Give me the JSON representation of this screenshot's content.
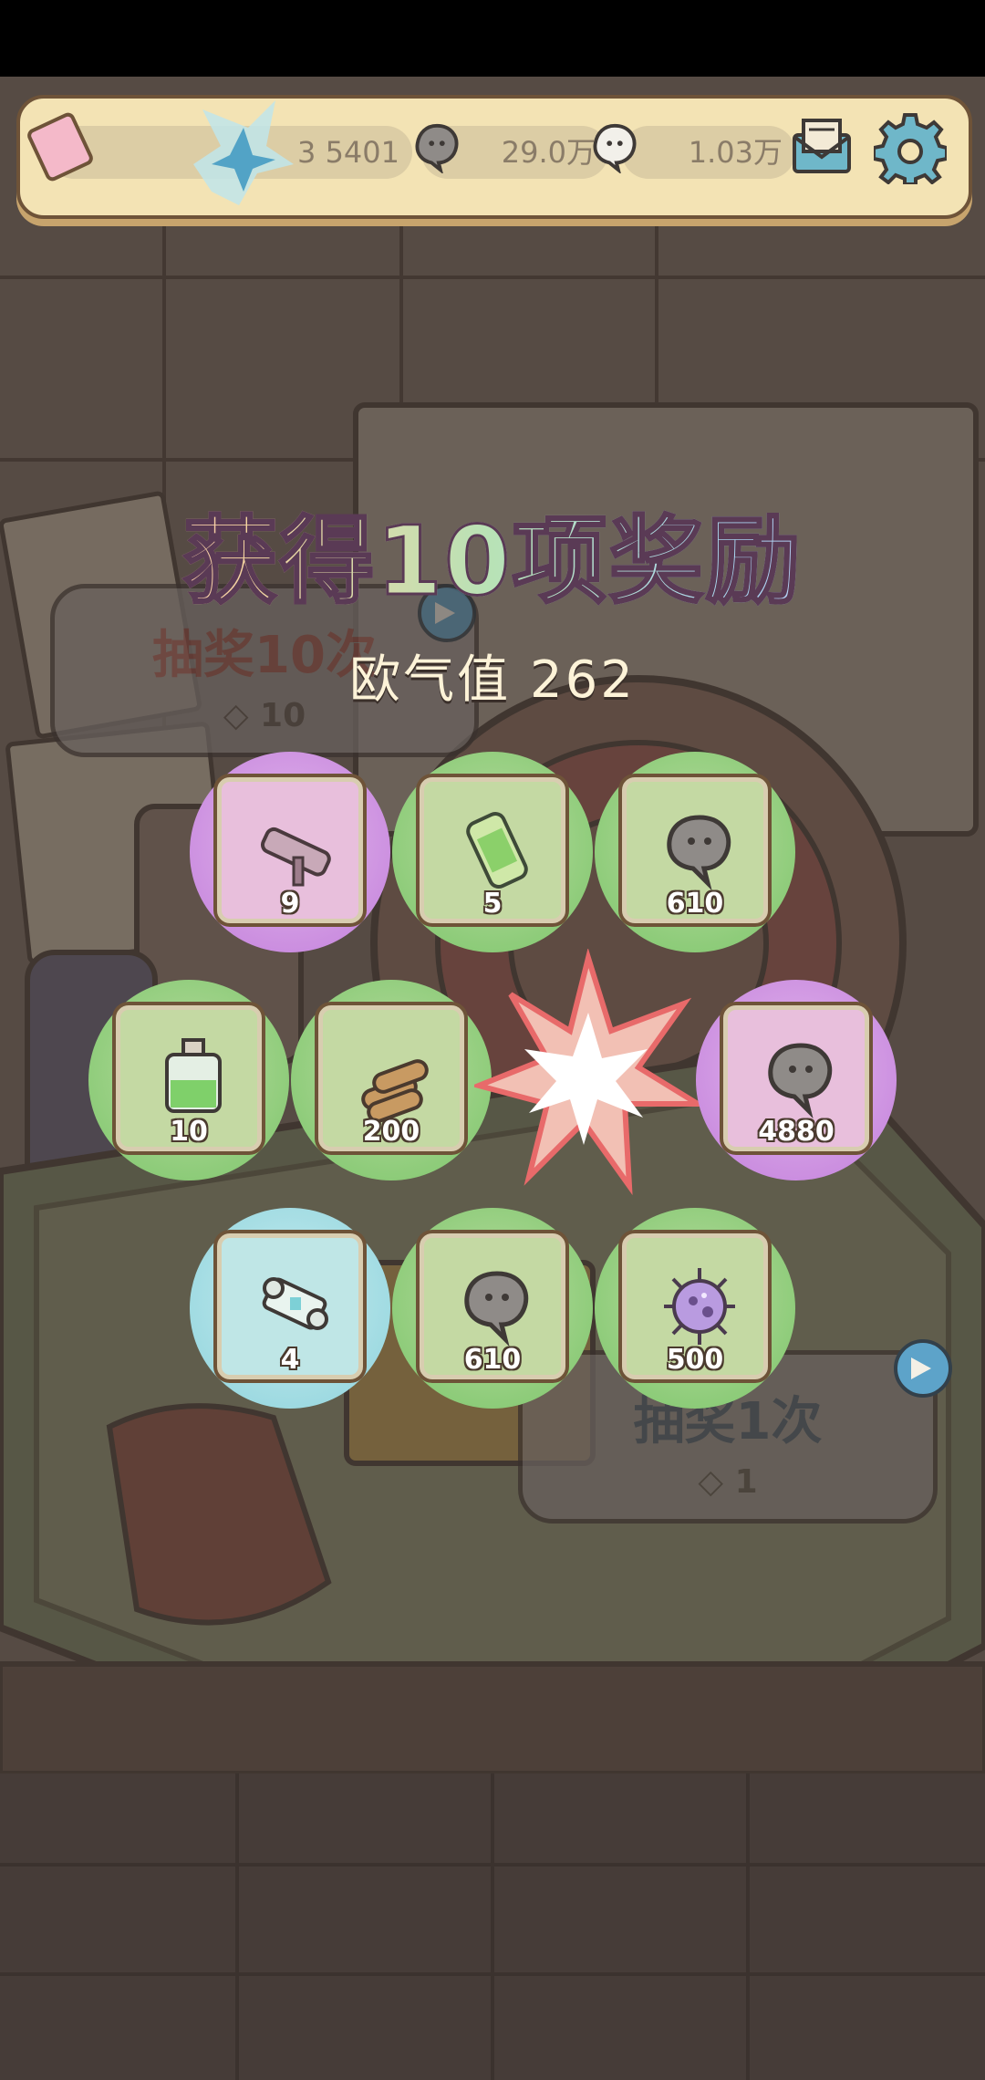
{
  "resources": {
    "ticket_value": "3   5401",
    "ghost_value": "29.0万",
    "soul_value": "1.03万"
  },
  "title": "获得10项奖励",
  "luck_text": "欧气值 262",
  "draw10": {
    "label": "抽奖10次",
    "cost": "10"
  },
  "draw1": {
    "label": "抽奖1次",
    "cost": "1"
  },
  "rewards": [
    {
      "name": "cannon",
      "quantity": "9",
      "rarity": "purple"
    },
    {
      "name": "glass-tube",
      "quantity": "5",
      "rarity": "green"
    },
    {
      "name": "ghost-soul",
      "quantity": "610",
      "rarity": "green"
    },
    {
      "name": "potion-bottle",
      "quantity": "10",
      "rarity": "green"
    },
    {
      "name": "wood-logs",
      "quantity": "200",
      "rarity": "green"
    },
    {
      "name": "ghost-soul",
      "quantity": "4880",
      "rarity": "purple"
    },
    {
      "name": "scroll",
      "quantity": "4",
      "rarity": "blue"
    },
    {
      "name": "ghost-soul",
      "quantity": "610",
      "rarity": "green"
    },
    {
      "name": "virus-germ",
      "quantity": "500",
      "rarity": "green"
    }
  ],
  "colors": {
    "green": "#7cc56a",
    "purple": "#c27fdb",
    "blue": "#8fd3dc"
  }
}
